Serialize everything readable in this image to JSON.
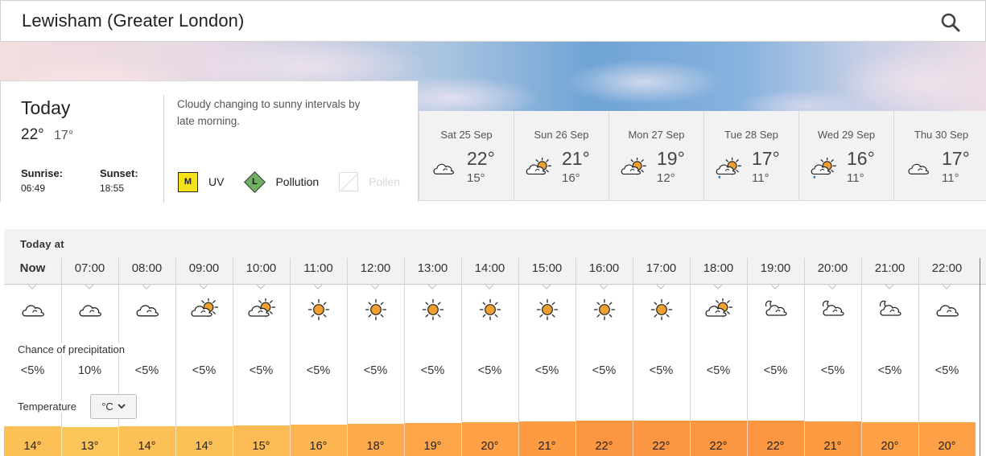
{
  "header": {
    "location": "Lewisham (Greater London)",
    "search_icon": "search-icon"
  },
  "today": {
    "label": "Today",
    "high": "22°",
    "low": "17°",
    "sunrise_label": "Sunrise:",
    "sunrise": "06:49",
    "sunset_label": "Sunset:",
    "sunset": "18:55",
    "summary": "Cloudy changing to sunny intervals by late morning.",
    "uv": {
      "code": "M",
      "label": "UV",
      "color": "#f5e11c"
    },
    "pollution": {
      "code": "L",
      "label": "Pollution",
      "color": "#6fb062"
    },
    "pollen": {
      "label": "Pollen",
      "available": false
    }
  },
  "days": [
    {
      "date": "Sat 25 Sep",
      "high": "22°",
      "low": "15°",
      "icon": "cloud"
    },
    {
      "date": "Sun 26 Sep",
      "high": "21°",
      "low": "16°",
      "icon": "sun-cloud"
    },
    {
      "date": "Mon 27 Sep",
      "high": "19°",
      "low": "12°",
      "icon": "sun-cloud"
    },
    {
      "date": "Tue 28 Sep",
      "high": "17°",
      "low": "11°",
      "icon": "sun-cloud-rain"
    },
    {
      "date": "Wed 29 Sep",
      "high": "16°",
      "low": "11°",
      "icon": "sun-cloud-rain"
    },
    {
      "date": "Thu 30 Sep",
      "high": "17°",
      "low": "11°",
      "icon": "cloud"
    }
  ],
  "hourly": {
    "heading": "Today at",
    "precip_label": "Chance of precipitation",
    "temp_label": "Temperature",
    "unit": "°C",
    "hours": [
      {
        "time": "Now",
        "icon": "cloud",
        "precip": "<5%",
        "temp": "14°",
        "t": 14
      },
      {
        "time": "07:00",
        "icon": "cloud",
        "precip": "10%",
        "temp": "13°",
        "t": 13
      },
      {
        "time": "08:00",
        "icon": "cloud",
        "precip": "<5%",
        "temp": "14°",
        "t": 14
      },
      {
        "time": "09:00",
        "icon": "sun-cloud",
        "precip": "<5%",
        "temp": "14°",
        "t": 14
      },
      {
        "time": "10:00",
        "icon": "sun-cloud",
        "precip": "<5%",
        "temp": "15°",
        "t": 15
      },
      {
        "time": "11:00",
        "icon": "sun",
        "precip": "<5%",
        "temp": "16°",
        "t": 16
      },
      {
        "time": "12:00",
        "icon": "sun",
        "precip": "<5%",
        "temp": "18°",
        "t": 18
      },
      {
        "time": "13:00",
        "icon": "sun",
        "precip": "<5%",
        "temp": "19°",
        "t": 19
      },
      {
        "time": "14:00",
        "icon": "sun",
        "precip": "<5%",
        "temp": "20°",
        "t": 20
      },
      {
        "time": "15:00",
        "icon": "sun",
        "precip": "<5%",
        "temp": "21°",
        "t": 21
      },
      {
        "time": "16:00",
        "icon": "sun",
        "precip": "<5%",
        "temp": "22°",
        "t": 22
      },
      {
        "time": "17:00",
        "icon": "sun",
        "precip": "<5%",
        "temp": "22°",
        "t": 22
      },
      {
        "time": "18:00",
        "icon": "sun-cloud",
        "precip": "<5%",
        "temp": "22°",
        "t": 22
      },
      {
        "time": "19:00",
        "icon": "moon-cloud",
        "precip": "<5%",
        "temp": "22°",
        "t": 22
      },
      {
        "time": "20:00",
        "icon": "moon-cloud",
        "precip": "<5%",
        "temp": "21°",
        "t": 21
      },
      {
        "time": "21:00",
        "icon": "moon-cloud",
        "precip": "<5%",
        "temp": "20°",
        "t": 20
      },
      {
        "time": "22:00",
        "icon": "cloud",
        "precip": "<5%",
        "temp": "20°",
        "t": 20
      }
    ]
  },
  "colors": {
    "sun": "#f0a030",
    "rain": "#2a7fc0",
    "temp_cool": "#fcc55a",
    "temp_warm": "#fd9640"
  }
}
